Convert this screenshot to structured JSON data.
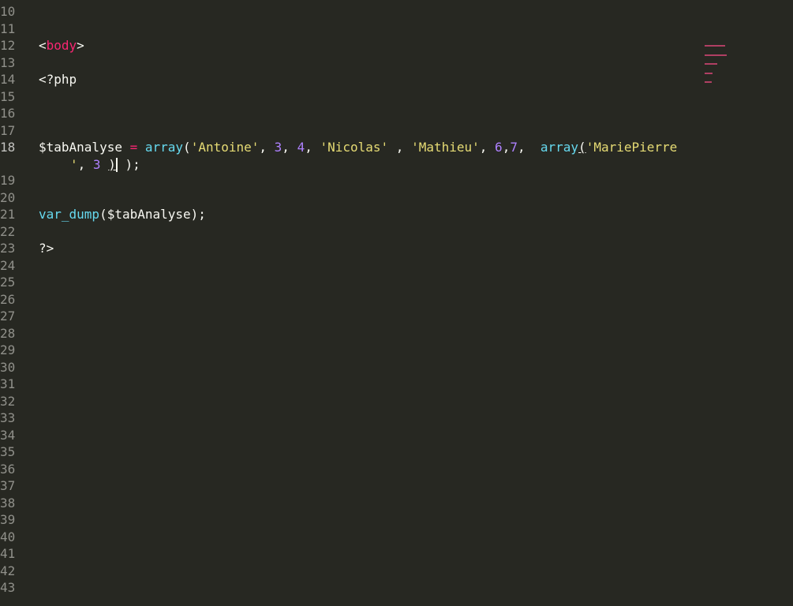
{
  "editor": {
    "theme_colors": {
      "background": "#272822",
      "tag": "#f92672",
      "function": "#66d9ef",
      "string": "#e6db74",
      "number": "#ae81ff",
      "text": "#f8f8f2",
      "gutter_text": "#90908a"
    },
    "line_numbers": [
      "10",
      "11",
      "12",
      "13",
      "14",
      "15",
      "16",
      "17",
      "18",
      "19",
      "20",
      "21",
      "22",
      "23",
      "24",
      "25",
      "26",
      "27",
      "28",
      "29",
      "30",
      "31",
      "32",
      "33",
      "34",
      "35",
      "36",
      "37",
      "38",
      "39",
      "40",
      "41",
      "42",
      "43"
    ],
    "active_line": "18",
    "code": {
      "line12": {
        "lt": "<",
        "tag": "body",
        "gt": ">"
      },
      "line14": "<?php",
      "line18": {
        "var": "$tabAnalyse",
        "eq": " = ",
        "fn1": "array",
        "p1": "(",
        "s1": "'Antoine'",
        "c1": ", ",
        "n1": "3",
        "c2": ", ",
        "n2": "4",
        "c3": ", ",
        "s2": "'Nicolas'",
        "c4": " , ",
        "s3": "'Mathieu'",
        "c5": ", ",
        "n3": "6",
        "c6": ",",
        "n4": "7",
        "c7": ",  ",
        "fn2": "array",
        "p2": "(",
        "s4a": "'MariePierre",
        "s4b": "'",
        "c8": ", ",
        "n5": "3",
        "sp": " ",
        "p3": ")",
        "end": " );"
      },
      "line21": {
        "fn": "var_dump",
        "args": "($tabAnalyse);"
      },
      "line23": "?>"
    }
  }
}
